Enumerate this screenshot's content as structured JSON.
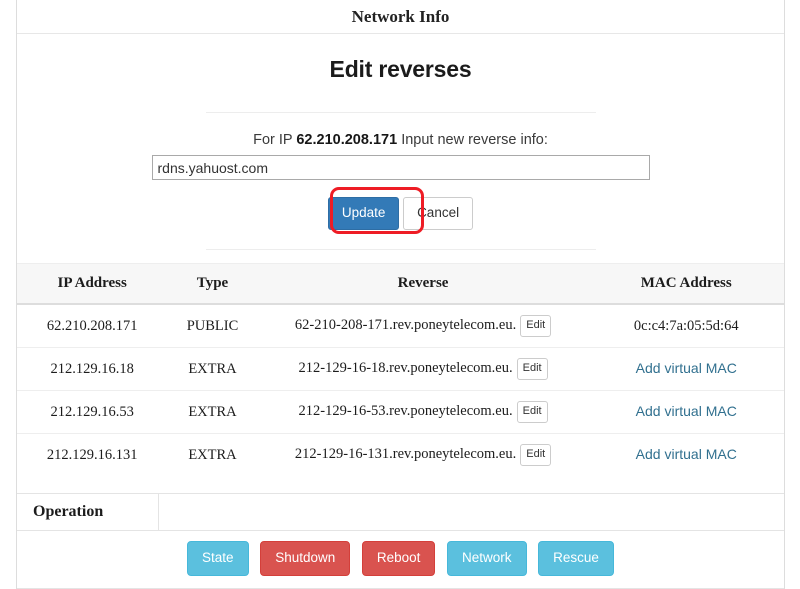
{
  "panel": {
    "heading": "Network Info"
  },
  "form": {
    "title": "Edit reverses",
    "label_prefix": "For IP",
    "label_ip": "62.210.208.171",
    "label_suffix": "Input new reverse info:",
    "input_value": "rdns.yahuost.com",
    "input_placeholder": "",
    "update_label": "Update",
    "cancel_label": "Cancel",
    "annotation_color": "#ee1c25",
    "primary_color": "#337ab7"
  },
  "table": {
    "headers": [
      "IP Address",
      "Type",
      "Reverse",
      "MAC Address"
    ],
    "edit_label": "Edit",
    "add_mac_label": "Add virtual MAC",
    "link_color": "#31708f",
    "rows": [
      {
        "ip": "62.210.208.171",
        "type": "PUBLIC",
        "reverse": "62-210-208-171.rev.poneytelecom.eu.",
        "mac": "0c:c4:7a:05:5d:64",
        "mac_is_link": false
      },
      {
        "ip": "212.129.16.18",
        "type": "EXTRA",
        "reverse": "212-129-16-18.rev.poneytelecom.eu.",
        "mac": "Add virtual MAC",
        "mac_is_link": true
      },
      {
        "ip": "212.129.16.53",
        "type": "EXTRA",
        "reverse": "212-129-16-53.rev.poneytelecom.eu.",
        "mac": "Add virtual MAC",
        "mac_is_link": true
      },
      {
        "ip": "212.129.16.131",
        "type": "EXTRA",
        "reverse": "212-129-16-131.rev.poneytelecom.eu.",
        "mac": "Add virtual MAC",
        "mac_is_link": true
      }
    ]
  },
  "operation": {
    "label": "Operation",
    "buttons": [
      {
        "label": "State",
        "style": "info",
        "color": "#5bc0de"
      },
      {
        "label": "Shutdown",
        "style": "danger",
        "color": "#d9534f"
      },
      {
        "label": "Reboot",
        "style": "danger",
        "color": "#d9534f"
      },
      {
        "label": "Network",
        "style": "info",
        "color": "#5bc0de"
      },
      {
        "label": "Rescue",
        "style": "info",
        "color": "#5bc0de"
      }
    ]
  }
}
